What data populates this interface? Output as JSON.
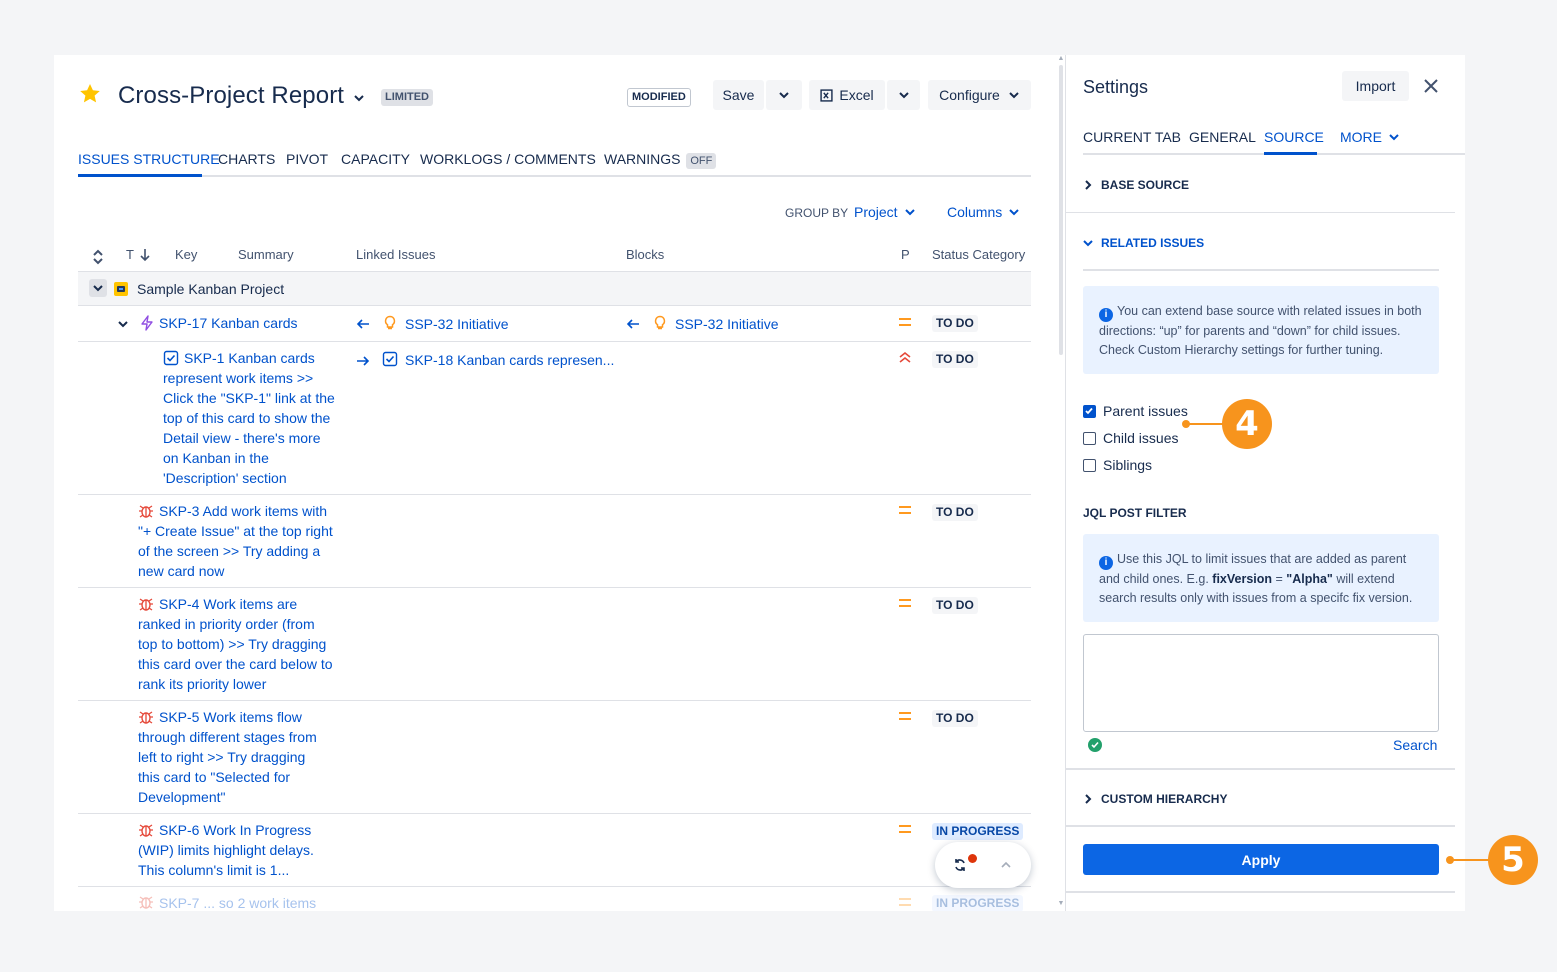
{
  "header": {
    "title": "Cross-Project Report",
    "limited_badge": "LIMITED",
    "modified_badge": "MODIFIED",
    "save_label": "Save",
    "excel_label": "Excel",
    "configure_label": "Configure"
  },
  "tabs": [
    {
      "label": "ISSUES STRUCTURE"
    },
    {
      "label": "CHARTS"
    },
    {
      "label": "PIVOT"
    },
    {
      "label": "CAPACITY"
    },
    {
      "label": "WORKLOGS / COMMENTS"
    },
    {
      "label": "WARNINGS",
      "badge": "OFF"
    }
  ],
  "toolbar": {
    "group_by_label": "GROUP BY",
    "group_by_value": "Project",
    "columns_label": "Columns"
  },
  "table": {
    "headers": {
      "t": "T",
      "key": "Key",
      "summary": "Summary",
      "linked": "Linked Issues",
      "blocks": "Blocks",
      "p": "P",
      "status": "Status Category"
    },
    "group_row": "Sample Kanban Project",
    "rows": [
      {
        "text": "SKP-17 Kanban cards",
        "linked": "SSP-32 Initiative",
        "blocks": "SSP-32 Initiative",
        "status": "TO DO"
      },
      {
        "lines": [
          "SKP-1 Kanban cards",
          "represent work items >>",
          "Click the \"SKP-1\" link at the",
          "top of this card to show the",
          "Detail view - there's more",
          "on Kanban in the",
          "'Description' section"
        ],
        "linked": "SKP-18 Kanban cards represen...",
        "status": "TO DO"
      },
      {
        "lines": [
          "SKP-3 Add work items with",
          "\"+ Create Issue\" at the top right",
          "of the screen >> Try adding a",
          "new card now"
        ],
        "status": "TO DO"
      },
      {
        "lines": [
          "SKP-4 Work items are",
          "ranked in priority order (from",
          "top to bottom) >> Try dragging",
          "this card over the card below to",
          "rank its priority lower"
        ],
        "status": "TO DO"
      },
      {
        "lines": [
          "SKP-5 Work items flow",
          "through different stages from",
          "left to right >> Try dragging",
          "this card to \"Selected for",
          "Development\""
        ],
        "status": "TO DO"
      },
      {
        "lines": [
          "SKP-6 Work In Progress",
          "(WIP) limits highlight delays.",
          "This column's limit is 1..."
        ],
        "status": "IN PROGRESS"
      },
      {
        "text": "SKP-7 ... so 2 work items",
        "status": "IN PROGRESS"
      }
    ]
  },
  "settings": {
    "title": "Settings",
    "import_label": "Import",
    "tabs": [
      "CURRENT TAB",
      "GENERAL",
      "SOURCE",
      "MORE"
    ],
    "base_source": "BASE SOURCE",
    "related_issues": "RELATED ISSUES",
    "related_info": "You can extend base source with related issues in both directions: “up” for parents and “down” for child issues. Check Custom Hierarchy settings for further tuning.",
    "checkboxes": [
      {
        "label": "Parent issues",
        "checked": true
      },
      {
        "label": "Child issues",
        "checked": false
      },
      {
        "label": "Siblings",
        "checked": false
      }
    ],
    "jql_title": "JQL POST FILTER",
    "jql_info_a": "Use this JQL to limit issues that are added as parent and child ones. E.g. ",
    "jql_info_b": "fixVersion",
    "jql_info_c": " = ",
    "jql_info_d": "\"Alpha\"",
    "jql_info_e": " will extend search results only with issues from a specifc fix version.",
    "jql_value": "",
    "search_label": "Search",
    "custom_hierarchy": "CUSTOM HIERARCHY",
    "apply_label": "Apply"
  },
  "callouts": {
    "four": "4",
    "five": "5"
  },
  "colors": {
    "accent": "#0052cc",
    "callout": "#f7941d",
    "bug": "#e5493a",
    "priority_medium": "#ff991f",
    "priority_high": "#e5493a"
  }
}
